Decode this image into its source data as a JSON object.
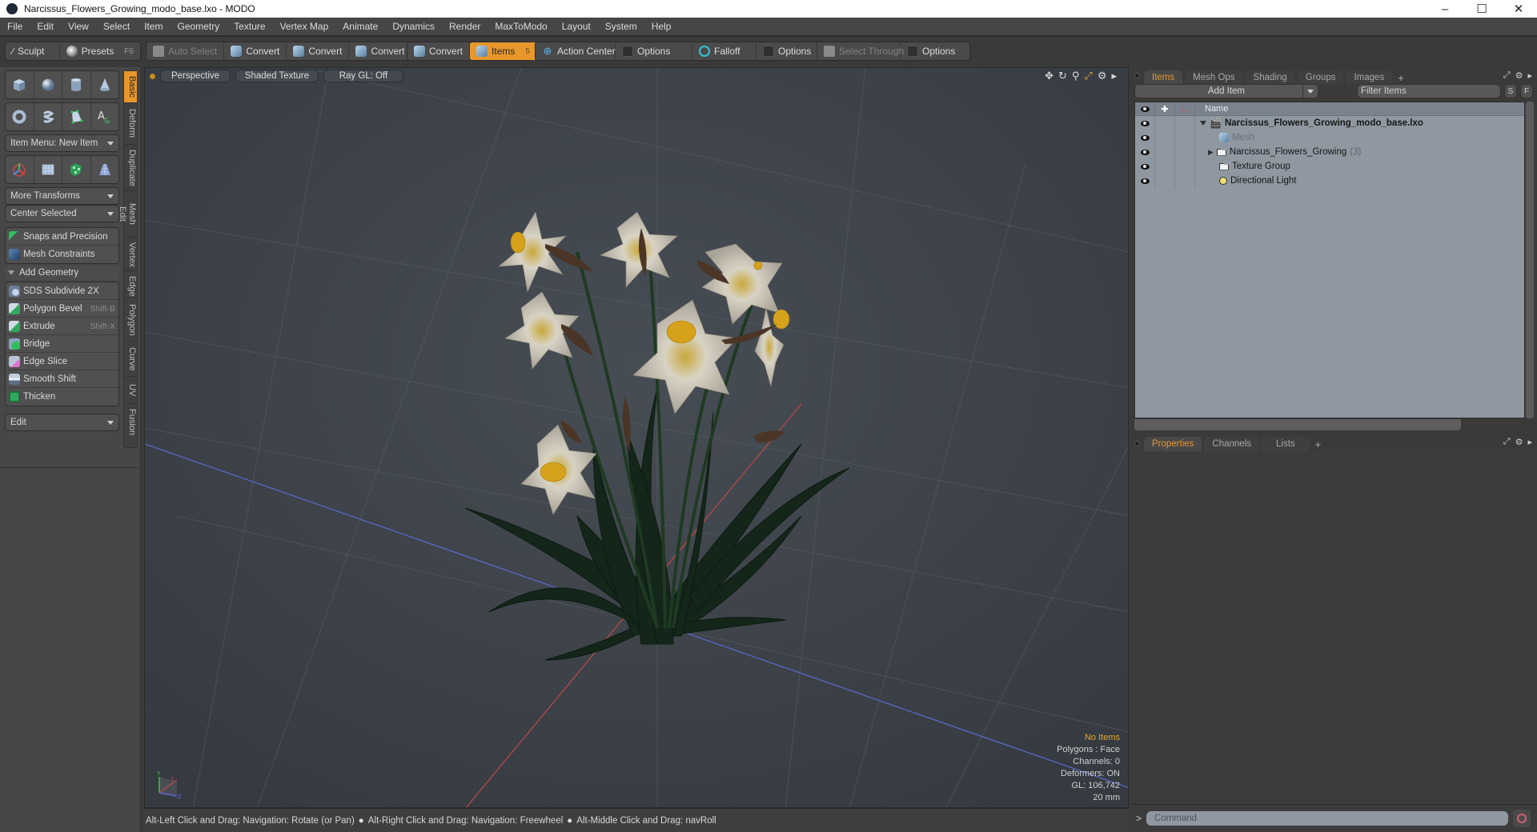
{
  "window": {
    "title": "Narcissus_Flowers_Growing_modo_base.lxo - MODO",
    "controls": [
      "minimize",
      "maximize",
      "close"
    ]
  },
  "menu": [
    "File",
    "Edit",
    "View",
    "Select",
    "Item",
    "Geometry",
    "Texture",
    "Vertex Map",
    "Animate",
    "Dynamics",
    "Render",
    "MaxToModo",
    "Layout",
    "System",
    "Help"
  ],
  "toolbar": {
    "sculpt": "Sculpt",
    "presets": "Presets",
    "presets_key": "F6",
    "auto_select": "Auto Select",
    "convert1": "Convert",
    "convert2": "Convert",
    "convert3": "Convert",
    "convert4": "Convert",
    "items": "Items",
    "items_key": "5",
    "action_center": "Action Center",
    "options1": "Options",
    "falloff": "Falloff",
    "options2": "Options",
    "select_through": "Select Through",
    "options3": "Options"
  },
  "left": {
    "vtabs": [
      "Basic",
      "Deform",
      "Duplicate",
      "Mesh Edit",
      "Vertex",
      "Edge",
      "Polygon",
      "Curve",
      "UV",
      "Fusion"
    ],
    "active_vtab": "Basic",
    "row1_icons": [
      "cube-icon",
      "sphere-icon",
      "cylinder-icon",
      "cone-icon"
    ],
    "row2_icons": [
      "torus-icon",
      "capsule-icon",
      "pen-polygon-icon",
      "text-icon"
    ],
    "item_menu": "Item Menu: New Item",
    "row3_icons": [
      "transform-icon",
      "mesh-plane-icon",
      "checker-icon",
      "grid-cone-icon"
    ],
    "more_transforms": "More Transforms",
    "center_selected": "Center Selected",
    "snaps": "Snaps and Precision",
    "constraints": "Mesh Constraints",
    "add_geometry": "Add Geometry",
    "tools": [
      {
        "label": "SDS Subdivide 2X",
        "shortcut": ""
      },
      {
        "label": "Polygon Bevel",
        "shortcut": "Shift-B"
      },
      {
        "label": "Extrude",
        "shortcut": "Shift-X"
      },
      {
        "label": "Bridge",
        "shortcut": ""
      },
      {
        "label": "Edge Slice",
        "shortcut": ""
      },
      {
        "label": "Smooth Shift",
        "shortcut": ""
      },
      {
        "label": "Thicken",
        "shortcut": ""
      }
    ],
    "edit": "Edit"
  },
  "viewport": {
    "view": "Perspective",
    "shading": "Shaded Texture",
    "raygl": "Ray GL: Off",
    "stats": {
      "selection": "No Items",
      "polygons": "Polygons : Face",
      "channels": "Channels: 0",
      "deformers": "Deformers: ON",
      "gl": "GL: 106,742",
      "scale": "20 mm"
    },
    "axis": {
      "x": "X",
      "y": "Y",
      "z": "Z"
    }
  },
  "status": {
    "hint1": "Alt-Left Click and Drag: Navigation: Rotate (or Pan)",
    "hint2": "Alt-Right Click and Drag: Navigation: Freewheel",
    "hint3": "Alt-Middle Click and Drag: navRoll"
  },
  "items_panel": {
    "tabs": [
      "Items",
      "Mesh Ops",
      "Shading",
      "Groups",
      "Images"
    ],
    "active_tab": "Items",
    "add_item": "Add Item",
    "filter_placeholder": "Filter Items",
    "s_btn": "S",
    "f_btn": "F",
    "name_col": "Name",
    "rows": [
      {
        "name": "Narcissus_Flowers_Growing_modo_base.lxo",
        "type": "scene",
        "bold": true,
        "count": ""
      },
      {
        "name": "Mesh",
        "type": "mesh",
        "dim": true,
        "count": ""
      },
      {
        "name": "Narcissus_Flowers_Growing",
        "type": "group",
        "count": "(3)"
      },
      {
        "name": "Texture Group",
        "type": "group",
        "count": ""
      },
      {
        "name": "Directional Light",
        "type": "light",
        "count": ""
      }
    ]
  },
  "props_panel": {
    "tabs": [
      "Properties",
      "Channels",
      "Lists"
    ],
    "active_tab": "Properties"
  },
  "command": {
    "prompt": ">",
    "placeholder": "Command"
  },
  "colors": {
    "accent": "#e8972a",
    "viewport_bg": "#3c4249",
    "tree_bg": "#8f98a1"
  }
}
